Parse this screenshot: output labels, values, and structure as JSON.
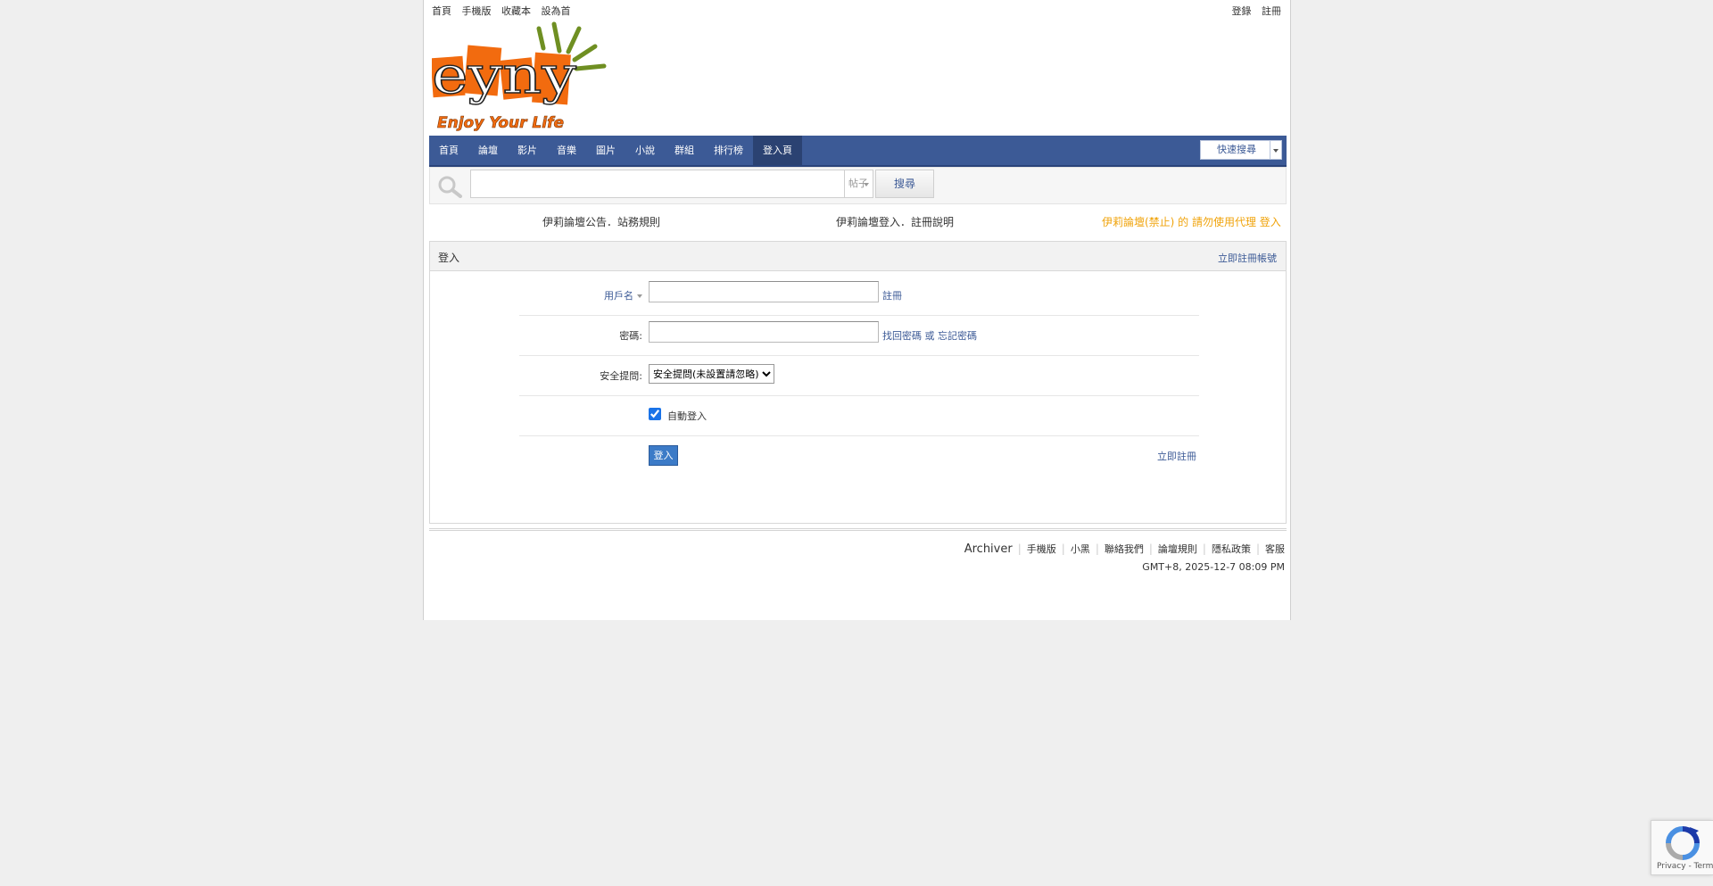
{
  "top_links": [
    "首頁",
    "手機版",
    "收藏本",
    "設為首"
  ],
  "top_right": [
    "登錄",
    "註冊"
  ],
  "logo": {
    "tagline": "Enjoy Your Life",
    "brand": "eyny"
  },
  "nav": {
    "items": [
      "首頁",
      "論壇",
      "影片",
      "音樂",
      "圖片",
      "小說",
      "群組",
      "排行榜",
      "登入頁"
    ],
    "active_index": 8,
    "search_toggle_label": "快速搜尋"
  },
  "search": {
    "placeholder": "",
    "type_label": "帖子",
    "button_label": "搜尋"
  },
  "notices": [
    {
      "text": "伊莉論壇公告．站務規則",
      "color": "#333333"
    },
    {
      "text": "伊莉論壇登入．註冊說明",
      "color": "#333333"
    },
    {
      "text": "伊莉論壇(禁止) 的 請勿使用代理 登入",
      "color": "#f0a30a"
    }
  ],
  "login": {
    "title": "登入",
    "head_link": "立即註冊帳號",
    "username_label": "用戶名",
    "username_after": "註冊",
    "password_label": "密碼:",
    "password_after": "找回密碼 或 忘記密碼",
    "question_label": "安全提問:",
    "question_option": "安全提問(未設置請忽略)",
    "autologin_label": "自動登入",
    "autologin_checked": true,
    "submit_label": "登入",
    "register_link": "立即註冊"
  },
  "footer": {
    "links": [
      "Archiver",
      "手機版",
      "小黑",
      "聯絡我們",
      "論壇規則",
      "隱私政策",
      "客服"
    ],
    "time": "GMT+8, 2025-12-7 08:09 PM"
  },
  "recaptcha": {
    "terms": "Privacy - Terms"
  }
}
